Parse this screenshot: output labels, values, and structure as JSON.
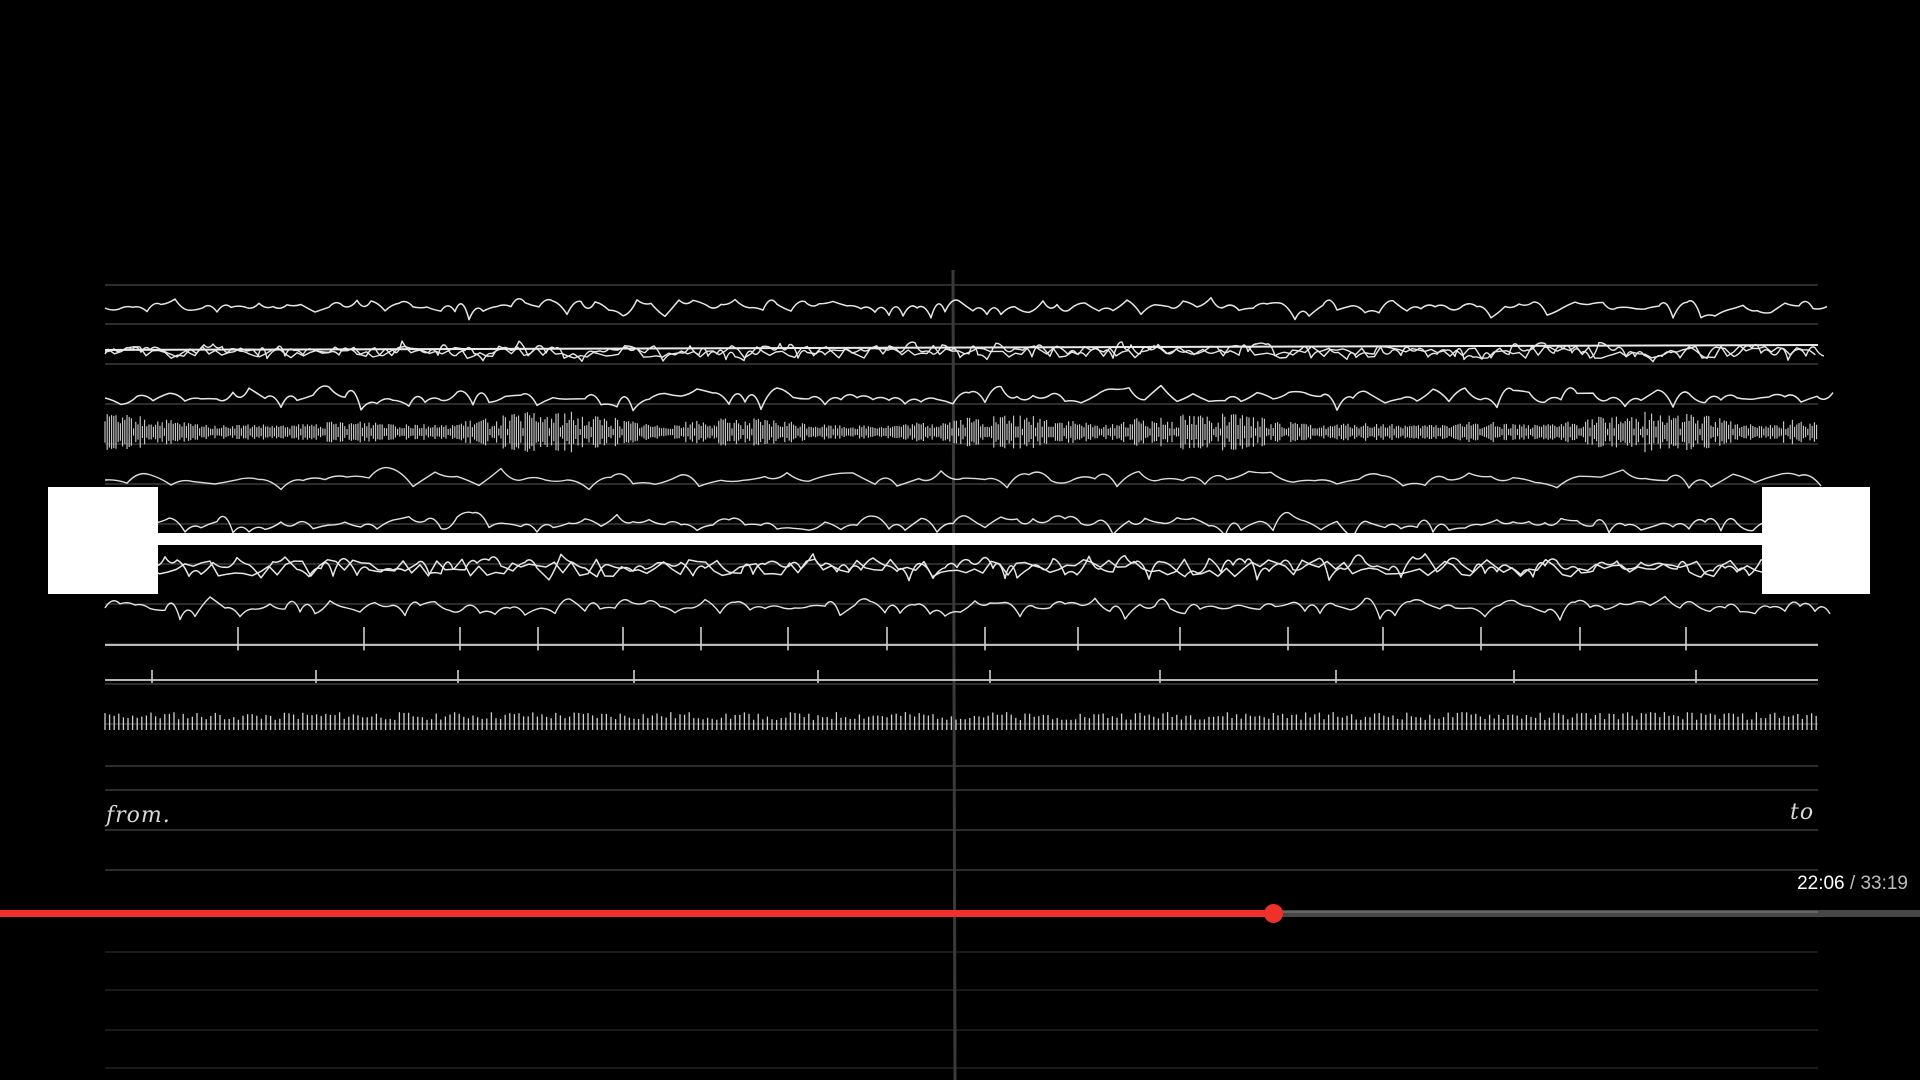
{
  "video": {
    "title": "",
    "handwritten_labels": {
      "from": "from.",
      "to": "to"
    }
  },
  "player": {
    "current_time": "22:06",
    "separator": "/",
    "duration": "33:19",
    "progress_fraction": 0.6632,
    "accent_color": "#f0302a"
  }
}
